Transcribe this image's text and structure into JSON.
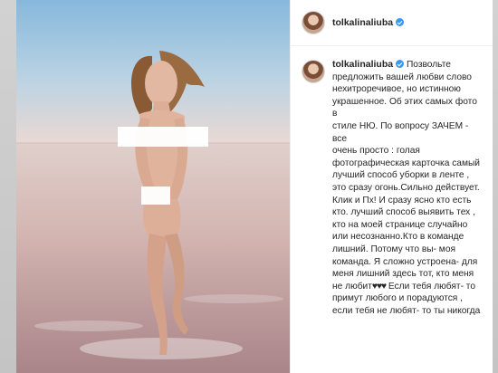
{
  "post": {
    "username": "tolkalinaliuba",
    "verified": true,
    "caption_lines": [
      "Позвольте",
      "предложить вашей любви слово",
      "нехитроречивое, но истинною",
      "украшенное. Об этих самых фото в",
      "стиле НЮ. По вопросу ЗАЧЕМ - все",
      "очень просто : голая",
      "фотографическая карточка самый",
      "лучший способ уборки в ленте ,",
      "это сразу огонь.Сильно действует.",
      "Клик и Пх! И сразу ясно кто есть",
      "кто. лучший способ выявить тех ,",
      "кто на моей странице случайно",
      "или несознанно.Кто в команде",
      "лишний. Потому что вы- моя",
      "команда. Я сложно устроена- для",
      "меня лишний здесь тот, кто меня",
      "не любит",
      "Если тебя любят- то",
      "примут любого и порадуются ,",
      "если тебя не любят- то ты никогда"
    ],
    "hearts": "♥♥♥",
    "colors": {
      "text": "#262626",
      "verified_badge": "#3897f0",
      "border": "#efefef"
    }
  }
}
